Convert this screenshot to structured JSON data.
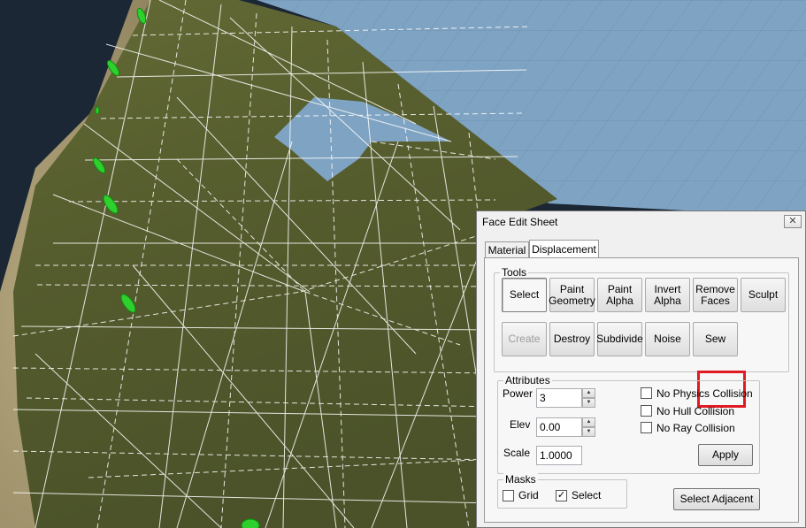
{
  "dialog": {
    "title": "Face Edit Sheet",
    "close_icon": "close-icon",
    "tabs": [
      {
        "label": "Material",
        "active": false
      },
      {
        "label": "Displacement",
        "active": true
      }
    ]
  },
  "tools": {
    "group_label": "Tools",
    "buttons": [
      {
        "label": "Select",
        "state": "active"
      },
      {
        "label": "Paint\nGeometry",
        "state": "normal"
      },
      {
        "label": "Paint\nAlpha",
        "state": "normal"
      },
      {
        "label": "Invert\nAlpha",
        "state": "normal"
      },
      {
        "label": "Remove\nFaces",
        "state": "normal"
      },
      {
        "label": "Sculpt",
        "state": "normal"
      },
      {
        "label": "Create",
        "state": "disabled"
      },
      {
        "label": "Destroy",
        "state": "normal"
      },
      {
        "label": "Subdivide",
        "state": "normal"
      },
      {
        "label": "Noise",
        "state": "normal"
      },
      {
        "label": "Sew",
        "state": "highlighted"
      }
    ],
    "highlight_color": "#e01a22"
  },
  "attributes": {
    "group_label": "Attributes",
    "power_label": "Power",
    "power_value": "3",
    "elev_label": "Elev",
    "elev_value": "0.00",
    "scale_label": "Scale",
    "scale_value": "1.0000",
    "no_physics_label": "No Physics Collision",
    "no_physics_checked": false,
    "no_hull_label": "No Hull Collision",
    "no_hull_checked": false,
    "no_ray_label": "No Ray Collision",
    "no_ray_checked": false,
    "apply_label": "Apply"
  },
  "masks": {
    "group_label": "Masks",
    "grid_label": "Grid",
    "grid_checked": false,
    "select_label": "Select",
    "select_checked": true,
    "check_glyph": "✓"
  },
  "select_adjacent_label": "Select Adjacent",
  "colors": {
    "water": "#7fa3c2",
    "terrain": "#59602f",
    "wire": "#ffffff",
    "marker": "#2dd02d"
  }
}
